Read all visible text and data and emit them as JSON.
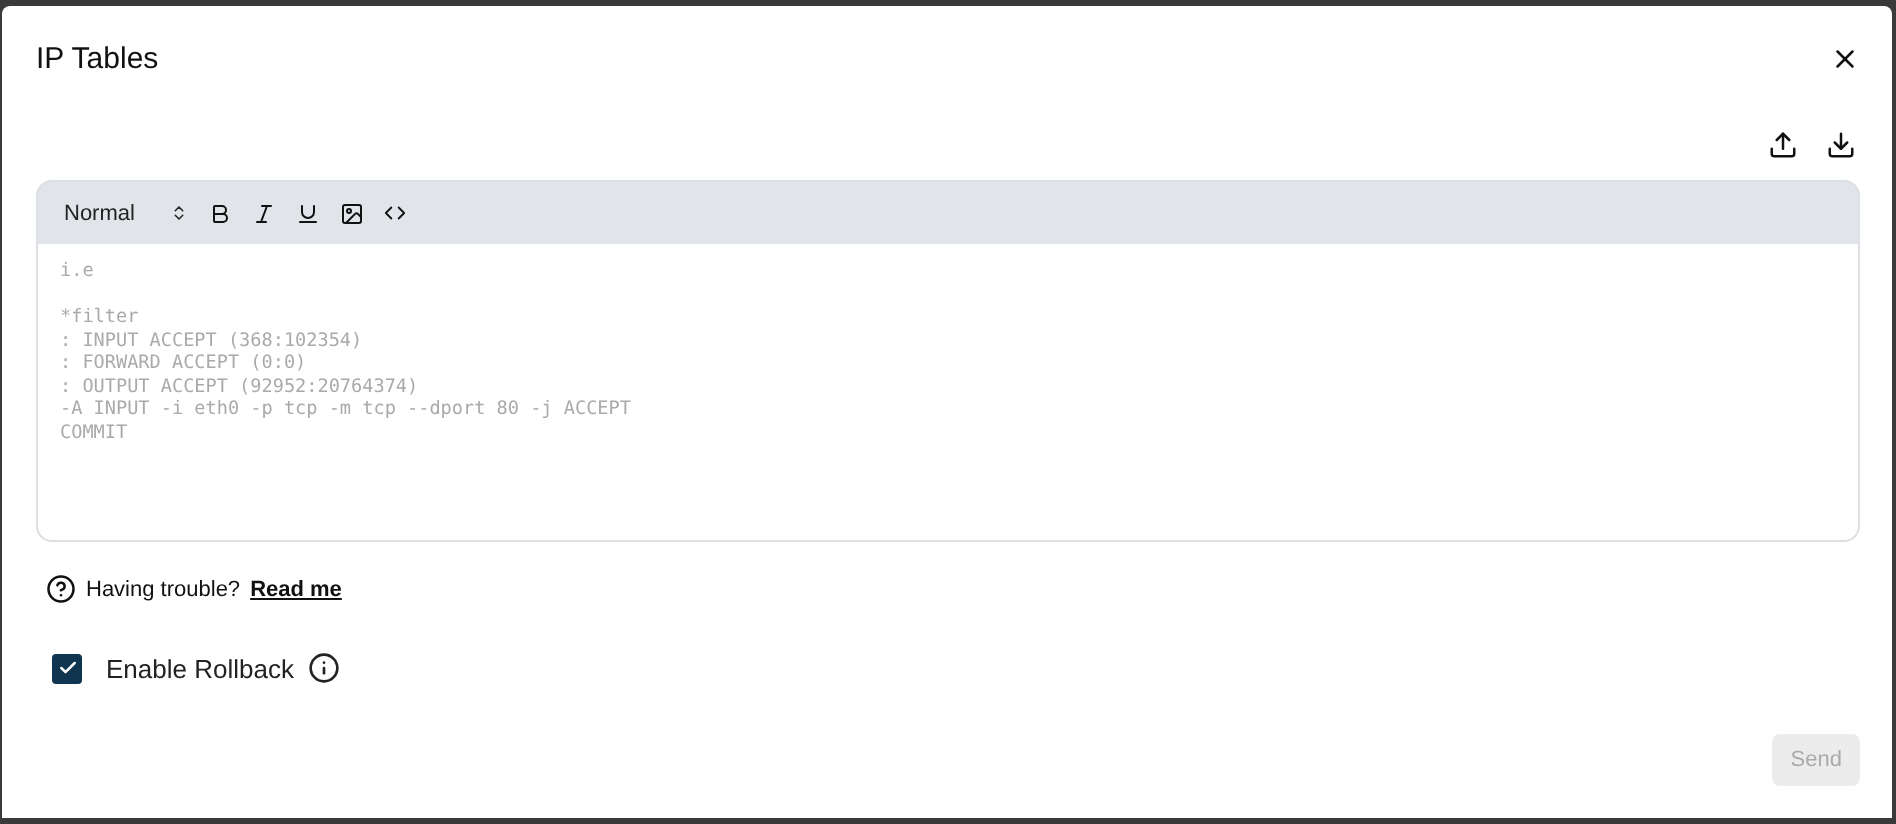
{
  "dialog": {
    "title": "IP Tables"
  },
  "editor": {
    "format": "Normal",
    "placeholder": "i.e\n\n*filter\n: INPUT ACCEPT (368:102354)\n: FORWARD ACCEPT (0:0)\n: OUTPUT ACCEPT (92952:20764374)\n-A INPUT -i eth0 -p tcp -m tcp --dport 80 -j ACCEPT\nCOMMIT"
  },
  "help": {
    "text": "Having trouble?",
    "link": "Read me"
  },
  "rollback": {
    "label": "Enable Rollback",
    "checked": true
  },
  "send": {
    "label": "Send",
    "disabled": true
  }
}
